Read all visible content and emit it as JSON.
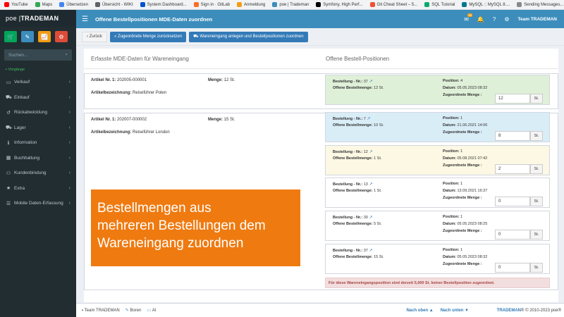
{
  "bookmarks": [
    {
      "label": "YouTube",
      "color": "#ff0000"
    },
    {
      "label": "Maps",
      "color": "#34a853"
    },
    {
      "label": "Übersetzen",
      "color": "#4285f4"
    },
    {
      "label": "Übersicht - WIKI",
      "color": "#5f6368"
    },
    {
      "label": "System Dashboard...",
      "color": "#0052cc"
    },
    {
      "label": "Sign in · GitLab",
      "color": "#fc6d26"
    },
    {
      "label": "Anmeldung",
      "color": "#f39c12"
    },
    {
      "label": "poe | Trademan",
      "color": "#3c8dbc"
    },
    {
      "label": "Symfony, High Perf...",
      "color": "#000000"
    },
    {
      "label": "Git Cheat Sheet – 5...",
      "color": "#f05033"
    },
    {
      "label": "SQL Tutorial",
      "color": "#04aa6d"
    },
    {
      "label": "MySQL :: MySQL 8....",
      "color": "#00758f"
    },
    {
      "label": "Sending Messages...",
      "color": "#888888"
    }
  ],
  "sidebar": {
    "logo_light": "poe |",
    "logo_bold": "TRADEMAN",
    "quick_buttons": [
      {
        "icon": "cart-icon",
        "glyph": "🛒",
        "color": "#00a65a"
      },
      {
        "icon": "pencil-icon",
        "glyph": "✎",
        "color": "#3c8dbc"
      },
      {
        "icon": "chart-icon",
        "glyph": "📈",
        "color": "#f39c12"
      },
      {
        "icon": "users-gear-icon",
        "glyph": "⚙",
        "color": "#dd4b39"
      }
    ],
    "search_placeholder": "Suchen...",
    "status": "Vorgänge",
    "items": [
      {
        "label": "Verkauf",
        "icon": "monitor-icon",
        "glyph": "▭"
      },
      {
        "label": "Einkauf",
        "icon": "cart-icon",
        "glyph": "⛟"
      },
      {
        "label": "Rückabwicklung",
        "icon": "undo-icon",
        "glyph": "↺"
      },
      {
        "label": "Lager",
        "icon": "truck-icon",
        "glyph": "⛟"
      },
      {
        "label": "Information",
        "icon": "info-icon",
        "glyph": "ℹ"
      },
      {
        "label": "Buchhaltung",
        "icon": "calculator-icon",
        "glyph": "▦"
      },
      {
        "label": "Kundenbindung",
        "icon": "users-icon",
        "glyph": "⚇"
      },
      {
        "label": "Extra",
        "icon": "star-icon",
        "glyph": "★"
      },
      {
        "label": "Mobile Daten-Erfassung",
        "icon": "hamburger-icon",
        "glyph": "☰"
      }
    ]
  },
  "topbar": {
    "title": "Offene Bestellpositionen MDE-Daten zuordnen",
    "badge": "99",
    "team": "Team TRADEMAN"
  },
  "toolbar": {
    "back": "‹ Zurück",
    "reset": "Zugeordnete Menge zurücksetzen",
    "create": "Wareneingang anlegen und Bestellpositionen zuordnen"
  },
  "headings": {
    "left": "Erfasste MDE-Daten für Wareneingang",
    "right": "Offene Bestell-Positionen"
  },
  "labels": {
    "article": "Artikel Nr. 1:",
    "amount": "Menge:",
    "designation": "Artikelbezeichnung:",
    "order": "Bestellung - Nr.:",
    "open": "Offene Bestellmenge:",
    "position": "Position:",
    "date": "Datum:",
    "assigned": "Zugeordnete Menge :"
  },
  "articles": [
    {
      "nr": "202005-000001",
      "amount": "12 St.",
      "designation": "Reiseführer Polen"
    },
    {
      "nr": "202007-000002",
      "amount": "15 St.",
      "designation": "Reiseführer London"
    }
  ],
  "orders": [
    {
      "nr": "37",
      "open": "12 St.",
      "position": "4",
      "date": "05.05.2023 08:32",
      "qty": "12",
      "unit": "St.",
      "color": "#dff0d8"
    },
    {
      "nr": "7",
      "open": "10 St.",
      "position": "1",
      "date": "21.06.2021 14:06",
      "qty": "8",
      "unit": "St.",
      "color": "#d9edf7"
    },
    {
      "nr": "12",
      "open": "1 St.",
      "position": "1",
      "date": "05.08.2021 07:42",
      "qty": "2",
      "unit": "St.",
      "color": "#fcf8e3"
    },
    {
      "nr": "13",
      "open": "1 St.",
      "position": "1",
      "date": "13.09.2021 16:37",
      "qty": "0",
      "unit": "St.",
      "color": "#ffffff"
    },
    {
      "nr": "30",
      "open": "5 St.",
      "position": "1",
      "date": "05.05.2023 08:25",
      "qty": "0",
      "unit": "St.",
      "color": "#ffffff"
    },
    {
      "nr": "37",
      "open": "15 St.",
      "position": "1",
      "date": "05.05.2023 08:32",
      "qty": "0",
      "unit": "St.",
      "color": "#ffffff"
    }
  ],
  "warning": "Für diese Wareneingangsposition sind derzeit 5,000 St. keiner Bestellposition zugeordnet.",
  "overlay": [
    "Bestellmengen aus",
    "mehreren Bestellungen dem",
    "Wareneingang zuordnen"
  ],
  "footer": {
    "team": "Team TRADEMAN",
    "boren": "Boren",
    "ai": "AI",
    "up": "Nach oben",
    "down": "Nach unten",
    "brand": "TRADEMAN",
    "copy": "® © 2010-2023 poe®"
  }
}
